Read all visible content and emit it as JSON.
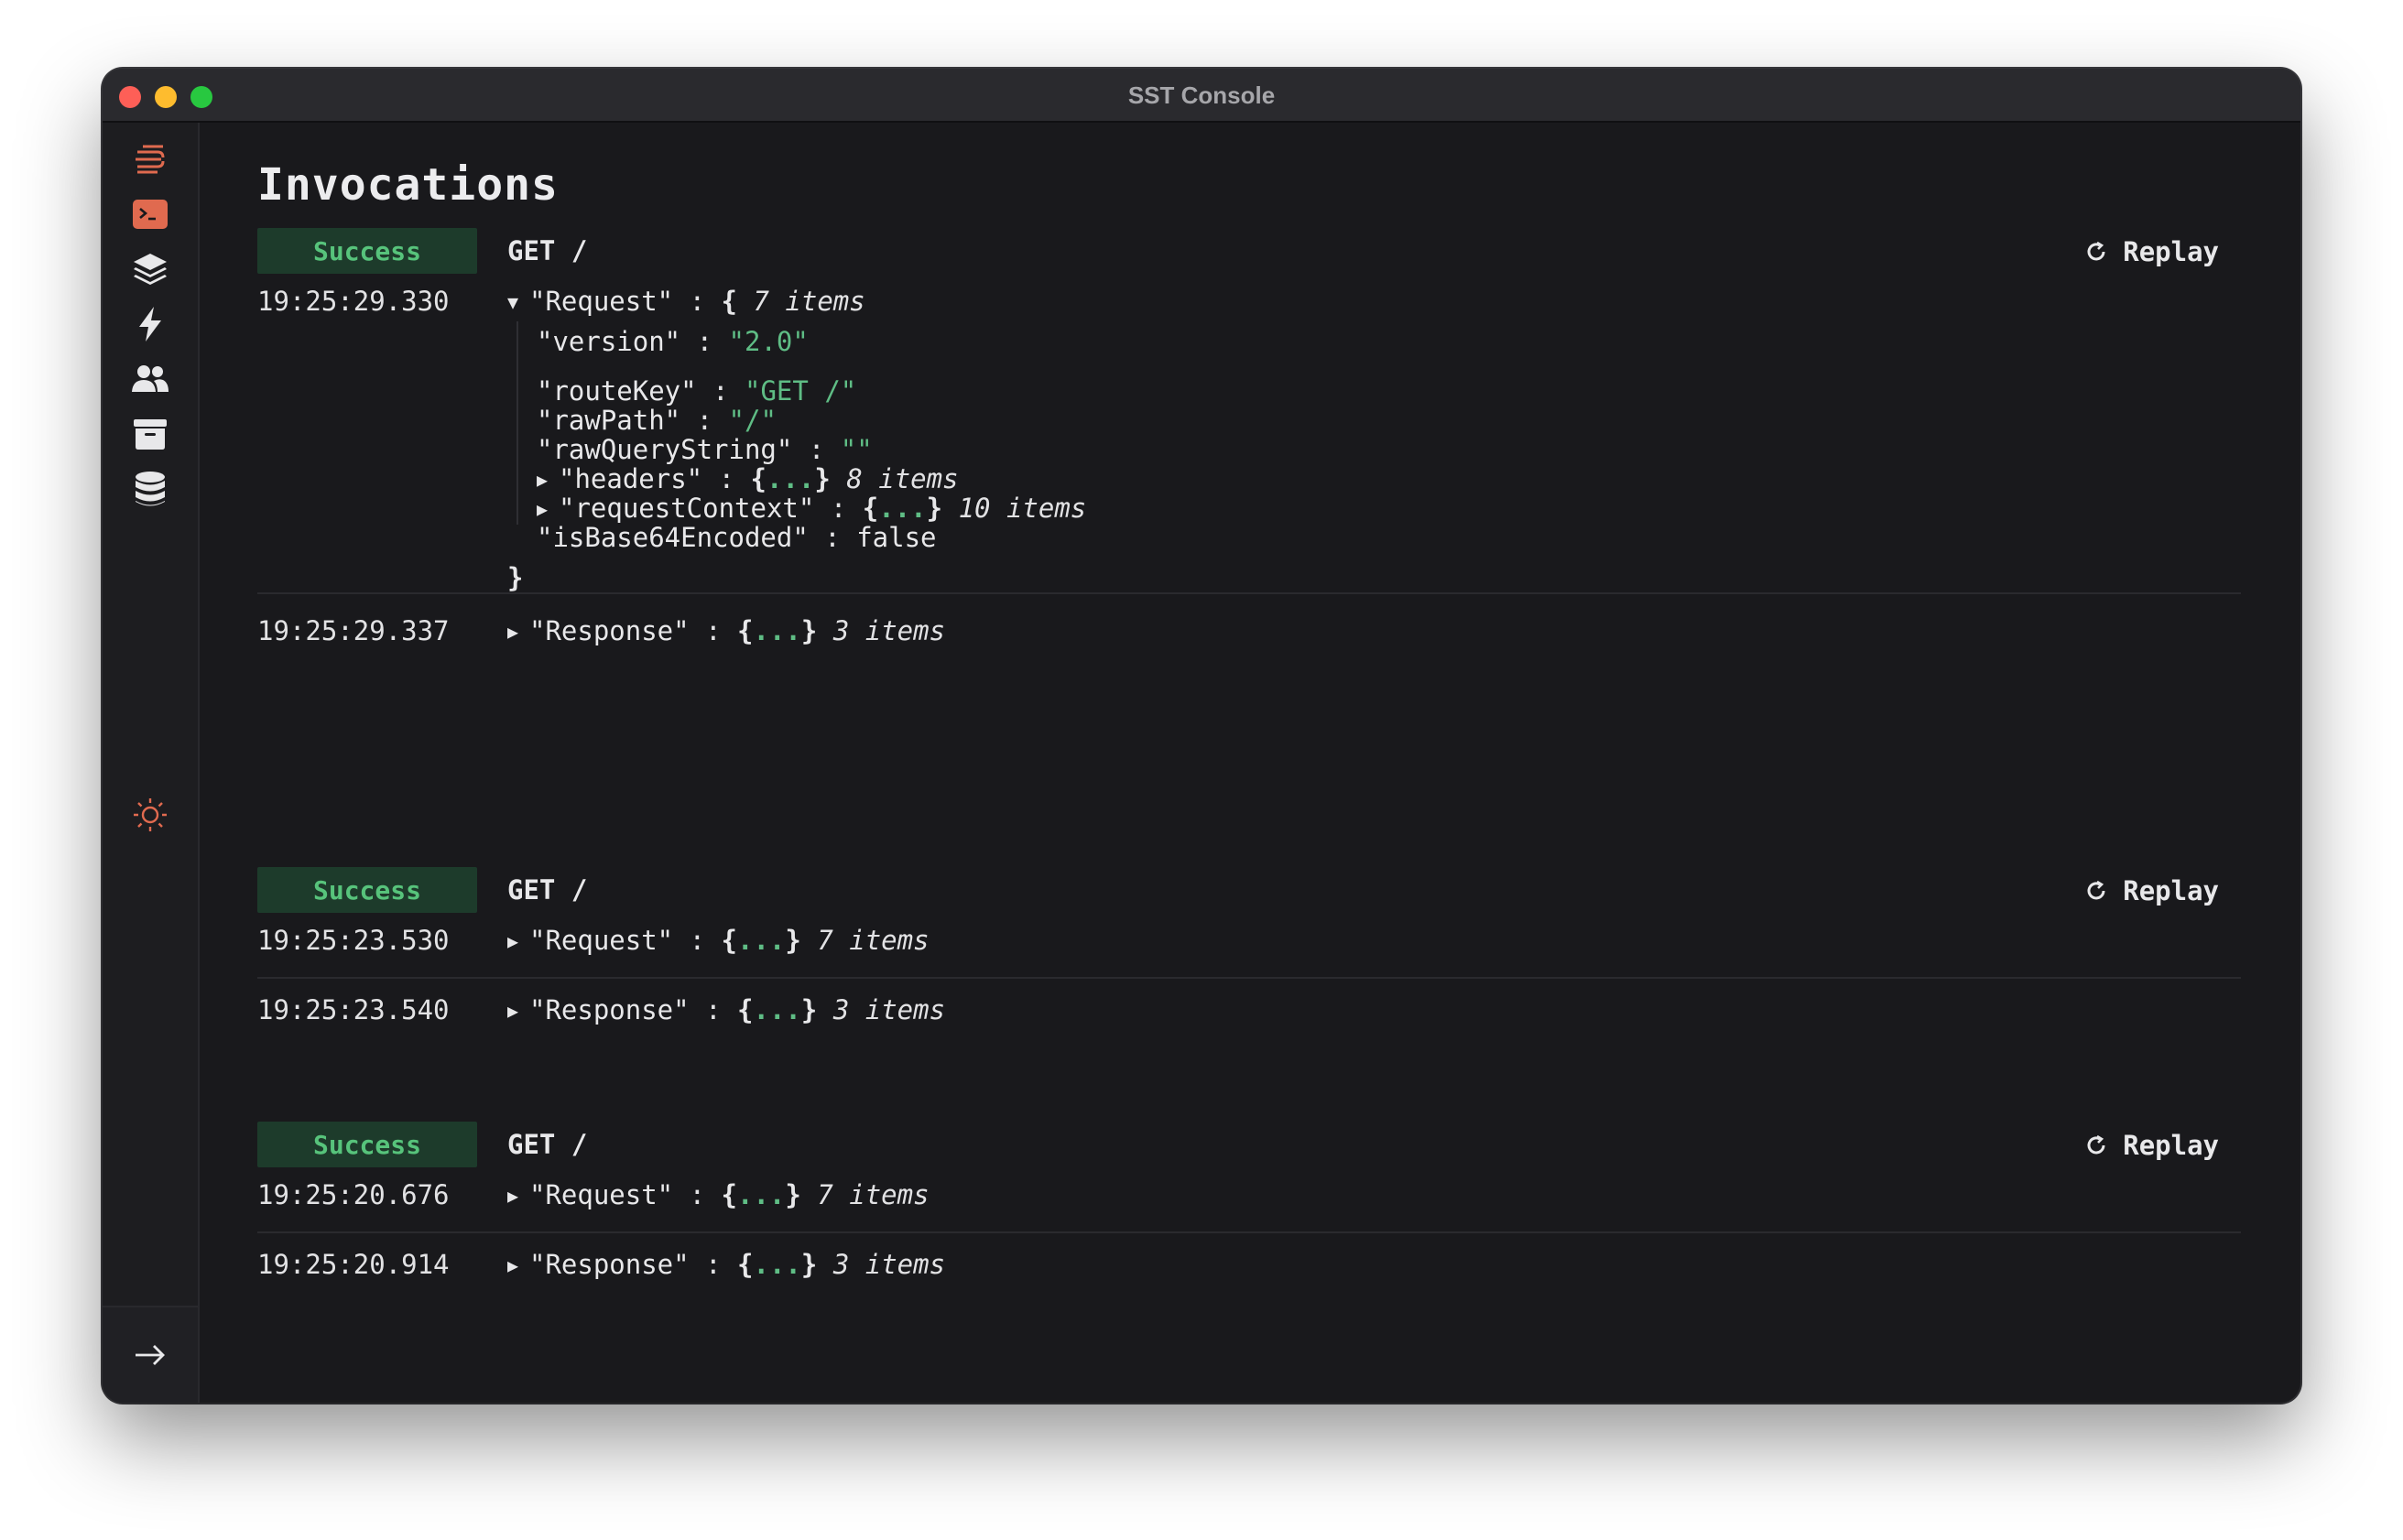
{
  "window": {
    "title": "SST Console"
  },
  "sidebar": {
    "items": [
      {
        "icon": "sst-logo-icon"
      },
      {
        "icon": "terminal-icon"
      },
      {
        "icon": "layers-icon"
      },
      {
        "icon": "lightning-icon"
      },
      {
        "icon": "users-icon"
      },
      {
        "icon": "archive-box-icon"
      },
      {
        "icon": "database-icon"
      }
    ],
    "theme_icon": "sun-icon",
    "expand_icon": "arrow-right-icon",
    "accent_color": "#e06a4f"
  },
  "main": {
    "title": "Invocations"
  },
  "colors": {
    "success_bg": "#1d3b2b",
    "success_text": "#57c37b",
    "string_value": "#5fbd85"
  },
  "invocations": [
    {
      "status": "Success",
      "route": "GET /",
      "replay_label": "Replay",
      "request": {
        "time": "19:25:29.330",
        "key": "\"Request\"",
        "open": "{",
        "count": "7 items",
        "fields": [
          {
            "key": "\"version\"",
            "value": "\"2.0\""
          },
          {
            "key": "\"routeKey\"",
            "value": "\"GET /\""
          },
          {
            "key": "\"rawPath\"",
            "value": "\"/\""
          },
          {
            "key": "\"rawQueryString\"",
            "value": "\"\""
          },
          {
            "key": "\"headers\"",
            "count": "8 items"
          },
          {
            "key": "\"requestContext\"",
            "count": "10 items"
          },
          {
            "key": "\"isBase64Encoded\"",
            "value": "false"
          }
        ],
        "close": "}"
      },
      "response": {
        "time": "19:25:29.337",
        "key": "\"Response\"",
        "count": "3 items"
      }
    },
    {
      "status": "Success",
      "route": "GET /",
      "replay_label": "Replay",
      "request": {
        "time": "19:25:23.530",
        "key": "\"Request\"",
        "count": "7 items"
      },
      "response": {
        "time": "19:25:23.540",
        "key": "\"Response\"",
        "count": "3 items"
      }
    },
    {
      "status": "Success",
      "route": "GET /",
      "replay_label": "Replay",
      "request": {
        "time": "19:25:20.676",
        "key": "\"Request\"",
        "count": "7 items"
      },
      "response": {
        "time": "19:25:20.914",
        "key": "\"Response\"",
        "count": "3 items"
      }
    }
  ],
  "json_tokens": {
    "colon": ":",
    "ellipsis": "...",
    "open": "{",
    "close": "}"
  }
}
